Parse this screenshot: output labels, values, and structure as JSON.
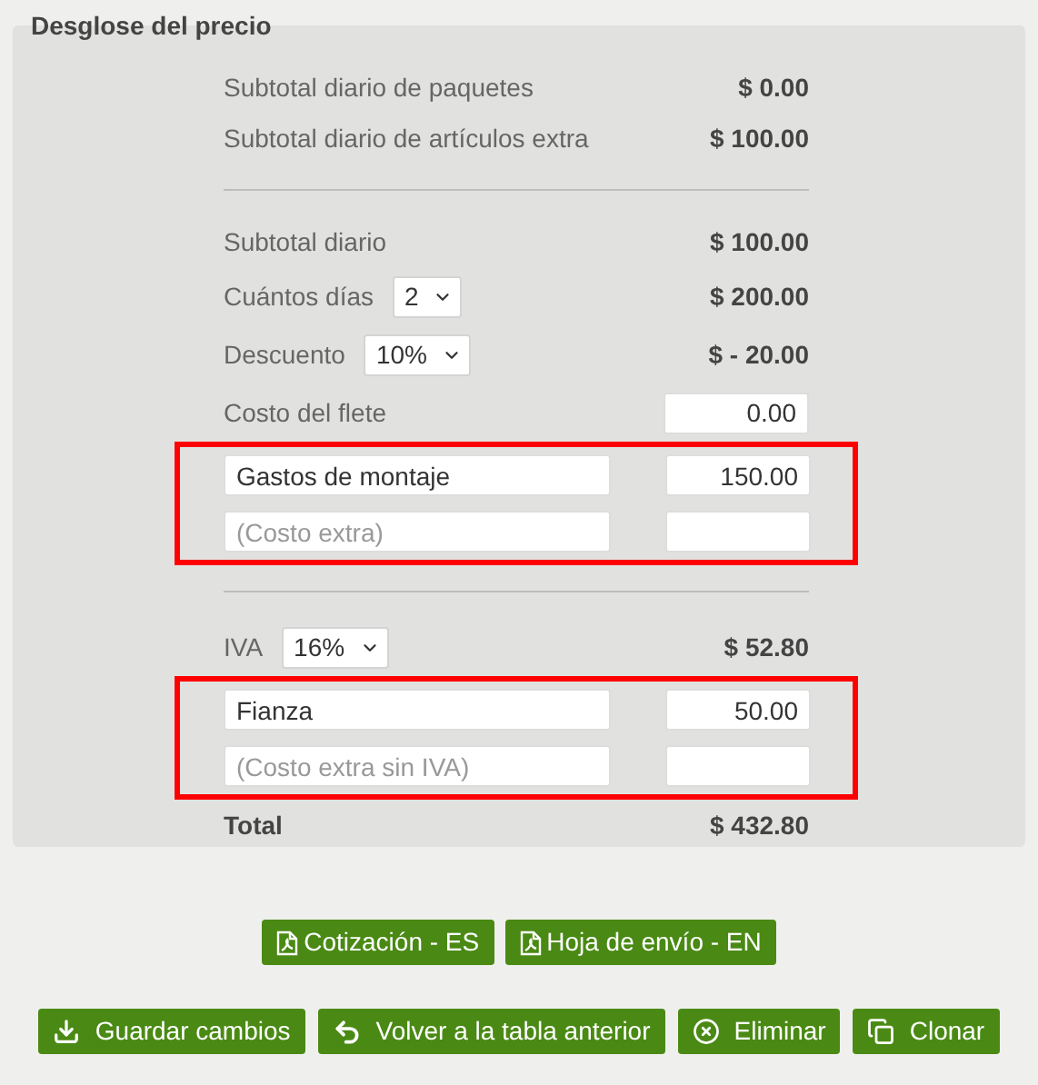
{
  "section": {
    "title": "Desglose del precio"
  },
  "rows": [
    {
      "kind": "amount",
      "label": "Subtotal diario de paquetes",
      "value": "$ 0.00"
    },
    {
      "kind": "amount",
      "label": "Subtotal diario de artículos extra",
      "value": "$ 100.00"
    },
    {
      "kind": "divider"
    },
    {
      "kind": "amount",
      "label": "Subtotal diario",
      "value": "$ 100.00"
    },
    {
      "kind": "select",
      "label": "Cuántos días",
      "option": "2",
      "value": "$ 200.00"
    },
    {
      "kind": "select",
      "label": "Descuento",
      "option": "10%",
      "value": "$ - 20.00"
    },
    {
      "kind": "input",
      "label": "Costo del flete",
      "amount": "0.00"
    },
    {
      "kind": "group",
      "highlighted": true,
      "items": [
        {
          "name": "Gastos de montaje",
          "amount": "150.00"
        },
        {
          "placeholder": "(Costo extra)"
        }
      ]
    },
    {
      "kind": "divider"
    },
    {
      "kind": "select",
      "label": "IVA",
      "option": "16%",
      "value": "$ 52.80"
    },
    {
      "kind": "group",
      "highlighted": true,
      "items": [
        {
          "name": "Fianza",
          "amount": "50.00"
        },
        {
          "placeholder": "(Costo extra sin IVA)"
        }
      ]
    },
    {
      "kind": "total",
      "label": "Total",
      "value": "$ 432.80"
    }
  ],
  "export_buttons": [
    {
      "label": "Cotización - ES"
    },
    {
      "label": "Hoja de envío - EN"
    }
  ],
  "action_buttons": [
    {
      "label": "Guardar cambios"
    },
    {
      "label": "Volver a la tabla anterior"
    },
    {
      "label": "Eliminar"
    },
    {
      "label": "Clonar"
    }
  ]
}
